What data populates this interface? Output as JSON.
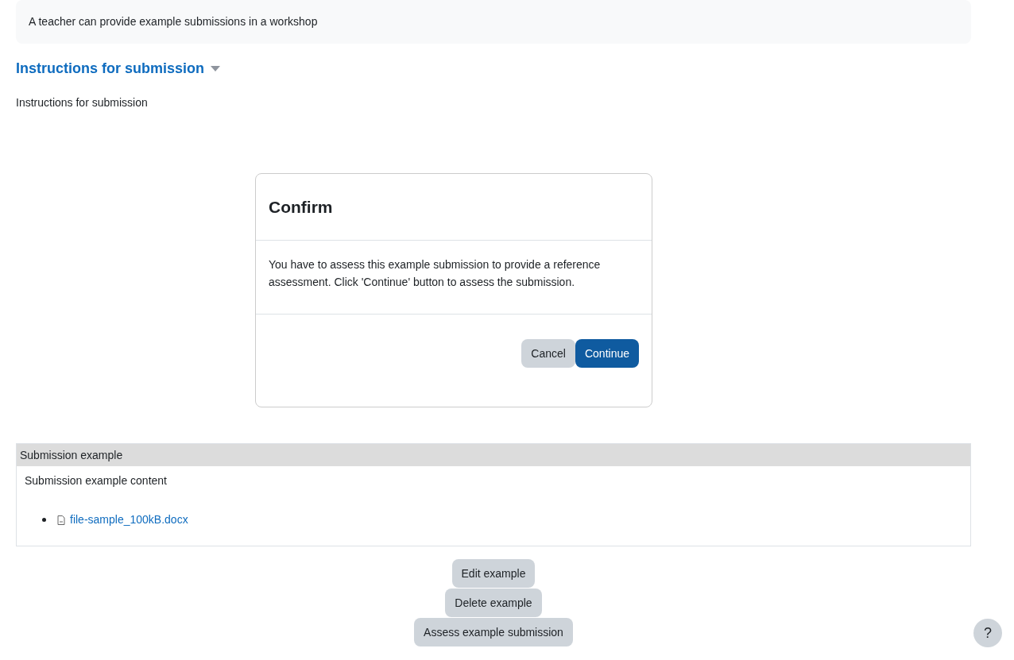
{
  "intro": "A teacher can provide example submissions in a workshop",
  "instructions": {
    "heading": "Instructions for submission",
    "expanded": true,
    "text": "Instructions for submission"
  },
  "dialog": {
    "title": "Confirm",
    "message": "You have to assess this example submission to provide a reference assessment. Click 'Continue' button to assess the submission.",
    "buttons": [
      {
        "label": "Cancel",
        "kind": "secondary"
      },
      {
        "label": "Continue",
        "kind": "primary"
      }
    ]
  },
  "submission": {
    "header": "Submission example",
    "content": "Submission example content",
    "files": [
      "file-sample_100kB.docx"
    ]
  },
  "actions": [
    "Edit example",
    "Delete example",
    "Assess example submission"
  ],
  "help_button": "?"
}
